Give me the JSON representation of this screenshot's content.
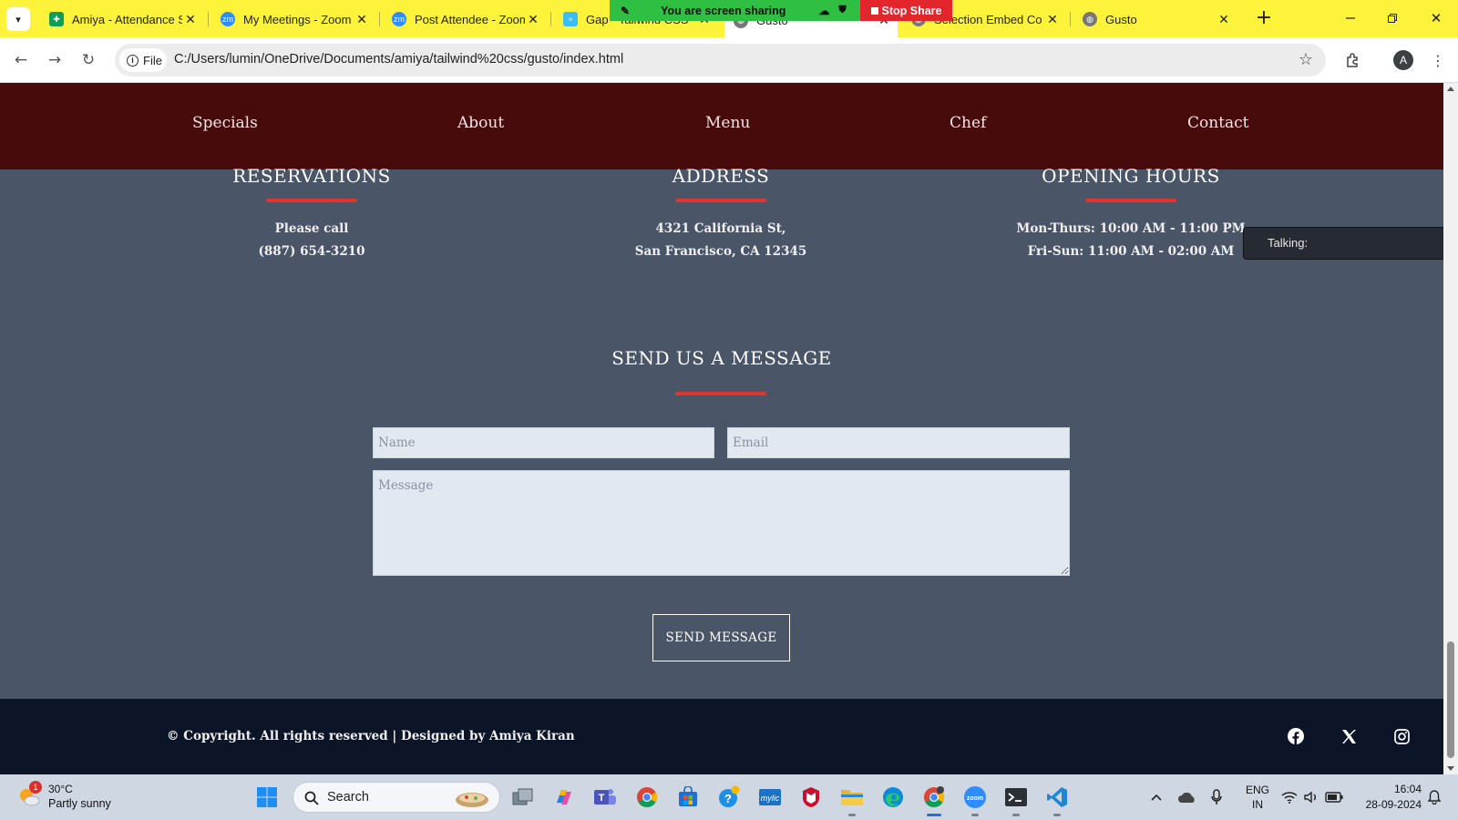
{
  "browser": {
    "tabs": [
      {
        "title": "Amiya - Attendance S",
        "favicon": "sheets-icon",
        "color": "#0f9d58"
      },
      {
        "title": "My Meetings - Zoom",
        "favicon": "zoom-icon",
        "color": "#2d8cff"
      },
      {
        "title": "Post Attendee - Zoom",
        "favicon": "zoom-icon",
        "color": "#2d8cff"
      },
      {
        "title": "Gap · Tailwind CSS",
        "favicon": "tailwind-icon",
        "color": "#38bdf8"
      },
      {
        "title": "Gusto",
        "favicon": "globe-icon",
        "color": "#555555"
      },
      {
        "title": "Selection Embed Co",
        "favicon": "globe-icon",
        "color": "#555555"
      },
      {
        "title": "Gusto",
        "favicon": "globe-icon",
        "color": "#555555"
      }
    ],
    "active_tab_index": 4,
    "url": "C:/Users/lumin/OneDrive/Documents/amiya/tailwind%20css/gusto/index.html",
    "url_chip": "File",
    "profile_initial": "A",
    "screen_share_banner": "You are screen sharing",
    "stop_share_label": "Stop Share"
  },
  "site": {
    "nav": [
      "Specials",
      "About",
      "Menu",
      "Chef",
      "Contact"
    ],
    "info": [
      {
        "heading": "RESERVATIONS",
        "line1": "Please call",
        "line2": "(887) 654-3210"
      },
      {
        "heading": "ADDRESS",
        "line1": "4321 California St,",
        "line2": "San Francisco, CA 12345"
      },
      {
        "heading": "OPENING HOURS",
        "line1": "Mon-Thurs: 10:00 AM - 11:00 PM",
        "line2": "Fri-Sun: 11:00 AM - 02:00 AM"
      }
    ],
    "talking_label": "Talking:",
    "contact": {
      "title": "SEND US A MESSAGE",
      "name_placeholder": "Name",
      "email_placeholder": "Email",
      "message_placeholder": "Message",
      "submit_label": "SEND MESSAGE"
    },
    "footer": {
      "copyright": "© Copyright. All rights reserved | Designed by Amiya Kiran",
      "social": [
        "facebook-icon",
        "x-icon",
        "instagram-icon"
      ]
    },
    "colors": {
      "nav_bg": "#480b0b",
      "section_bg": "#4a5568",
      "accent": "#e3342f",
      "footer_bg": "#0c1427"
    }
  },
  "taskbar": {
    "weather": {
      "temp": "30°C",
      "condition": "Partly sunny",
      "badge": "1"
    },
    "search_label": "Search",
    "lang_line1": "ENG",
    "lang_line2": "IN",
    "time": "16:04",
    "date": "28-09-2024"
  }
}
